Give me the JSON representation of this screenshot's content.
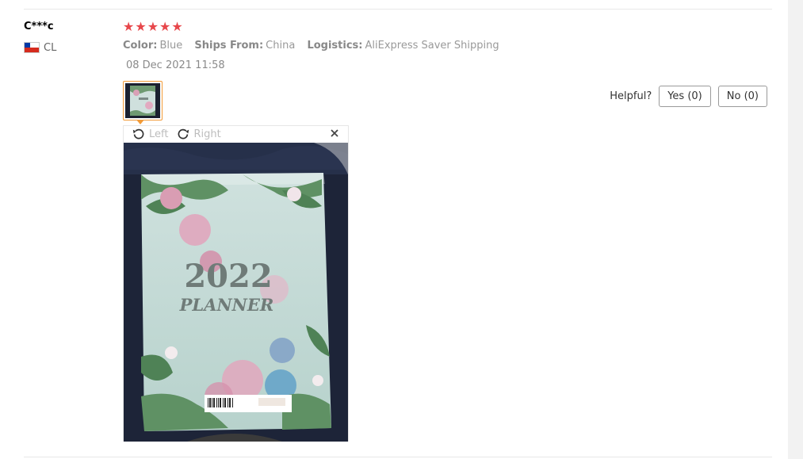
{
  "review": {
    "user": "C***c",
    "country": "CL",
    "rating": 5,
    "stars": [
      "★",
      "★",
      "★",
      "★",
      "★"
    ],
    "attributes": [
      {
        "key": "Color:",
        "value": "Blue"
      },
      {
        "key": "Ships From:",
        "value": "China"
      },
      {
        "key": "Logistics:",
        "value": "AliExpress Saver Shipping"
      }
    ],
    "date": "08 Dec 2021 11:58",
    "helpful": {
      "label": "Helpful?",
      "yes": "Yes (0)",
      "no": "No (0)"
    },
    "viewer": {
      "rotate_left": "Left",
      "rotate_right": "Right",
      "close_icon": "close-icon"
    },
    "photo_text": {
      "year": "2022",
      "title": "PLANNER"
    }
  },
  "colors": {
    "star": "#e7474b",
    "thumb_border": "#f29b38",
    "divider": "#e8e8e8"
  }
}
